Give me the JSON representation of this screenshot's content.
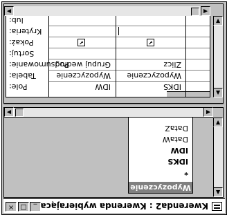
{
  "window": {
    "title": "Kwerenda2 : Kwerenda wybierająca",
    "minimize_label": "_",
    "maximize_label": "□",
    "close_label": "×"
  },
  "table": {
    "name": "Wypozyczenie",
    "fields": [
      "*",
      "IDKS",
      "IDW",
      "DataW",
      "DataZ"
    ]
  },
  "grid": {
    "row_labels": [
      "Pole:",
      "Tabela:",
      "Podsumowanie:",
      "Sortuj:",
      "Pokaż:",
      "Kryteria:",
      "lub:"
    ],
    "columns": [
      {
        "pole": "IDW",
        "tabela": "Wypozyczenie",
        "podsumowanie": "Grupuj według",
        "sortuj": "",
        "pokaz": true,
        "kryteria": "",
        "lub": ""
      },
      {
        "pole": "IDKS",
        "tabela": "Wypozyczenie",
        "podsumowanie": "Zlicz",
        "sortuj": "",
        "pokaz": true,
        "kryteria": "",
        "lub": ""
      }
    ]
  },
  "icons": {
    "app": "query-icon",
    "check": "checkmark-icon"
  }
}
